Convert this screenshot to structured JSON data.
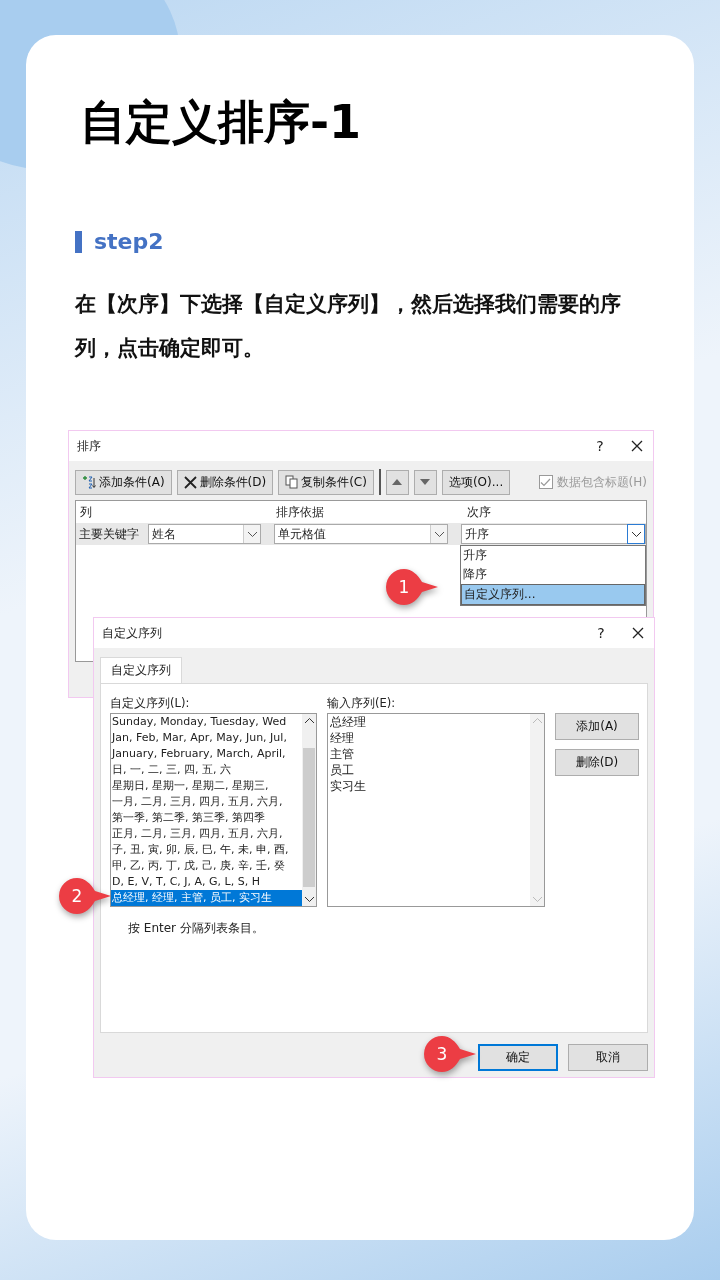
{
  "title": "自定义排序-1",
  "step": "step2",
  "instruction": "在【次序】下选择【自定义序列】，然后选择我们需要的序列，点击确定即可。",
  "sort_dialog": {
    "title": "排序",
    "help": "?",
    "toolbar": [
      {
        "kind": "add",
        "label": "添加条件(A)"
      },
      {
        "kind": "delete",
        "label": "删除条件(D)"
      },
      {
        "kind": "copy",
        "label": "复制条件(C)"
      }
    ],
    "options_button": "选项(O)...",
    "header_checkbox": {
      "label": "数据包含标题(H)",
      "checked": true,
      "disabled": true
    },
    "columns": [
      "列",
      "排序依据",
      "次序"
    ],
    "row": {
      "label": "主要关键字",
      "column": "姓名",
      "sort_on": "单元格值",
      "order": "升序"
    },
    "order_options": [
      {
        "label": "升序",
        "selected": false
      },
      {
        "label": "降序",
        "selected": false
      },
      {
        "label": "自定义序列...",
        "selected": true
      }
    ]
  },
  "custom_dialog": {
    "title": "自定义序列",
    "help": "?",
    "tabs": [
      {
        "label": "自定义序列",
        "selected": true
      }
    ],
    "lists_label": "自定义序列(L):",
    "lists": [
      {
        "text": "Sunday, Monday, Tuesday, Wed",
        "selected": false
      },
      {
        "text": "Jan, Feb, Mar, Apr, May, Jun, Jul,",
        "selected": false
      },
      {
        "text": "January, February, March, April,",
        "selected": false
      },
      {
        "text": "日, 一, 二, 三, 四, 五, 六",
        "selected": false
      },
      {
        "text": "星期日, 星期一, 星期二, 星期三,",
        "selected": false
      },
      {
        "text": "一月, 二月, 三月, 四月, 五月, 六月,",
        "selected": false
      },
      {
        "text": "第一季, 第二季, 第三季, 第四季",
        "selected": false
      },
      {
        "text": "正月, 二月, 三月, 四月, 五月, 六月,",
        "selected": false
      },
      {
        "text": "子, 丑, 寅, 卯, 辰, 巳, 午, 未, 申, 酉,",
        "selected": false
      },
      {
        "text": "甲, 乙, 丙, 丁, 戊, 己, 庚, 辛, 壬, 癸",
        "selected": false
      },
      {
        "text": "D, E, V, T, C, J, A, G, L, S, H",
        "selected": false
      },
      {
        "text": "总经理, 经理, 主管, 员工, 实习生",
        "selected": true
      }
    ],
    "entries_label": "输入序列(E):",
    "entries": [
      "总经理",
      "经理",
      "主管",
      "员工",
      "实习生"
    ],
    "side_buttons": [
      "添加(A)",
      "删除(D)"
    ],
    "hint": "按 Enter 分隔列表条目。",
    "buttons": [
      {
        "label": "确定",
        "default": true
      },
      {
        "label": "取消",
        "default": false
      }
    ]
  },
  "callouts": [
    "1",
    "2",
    "3"
  ]
}
